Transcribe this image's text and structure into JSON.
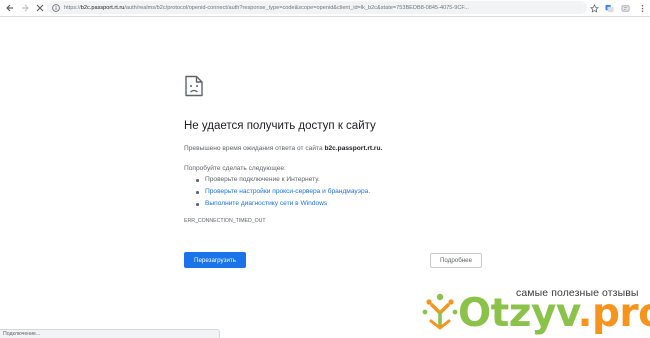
{
  "browser": {
    "url": {
      "scheme": "https://",
      "host": "b2c.passport.rt.ru",
      "rest": "/auth/realms/b2c/protocol/openid-connect/auth?response_type=code&scope=openid&client_id=lk_b2c&state=753BEDB8-0845-4075-9CF..."
    },
    "status_text": "Подключение..."
  },
  "error": {
    "title": "Не удается получить доступ к сайту",
    "description_prefix": "Превышено время ожидания ответа от сайта",
    "description_host": "b2c.passport.rt.ru.",
    "try_heading": "Попробуйте сделать следующее:",
    "suggestions": [
      {
        "text": "Проверьте подключение к Интернету.",
        "link": false
      },
      {
        "text": "Проверьте настройки прокси-сервера и брандмауэра.",
        "link": true
      },
      {
        "text": "Выполните диагностику сети в Windows",
        "link": true
      }
    ],
    "code": "ERR_CONNECTION_TIMED_OUT",
    "reload_label": "Перезагрузить",
    "details_label": "Подробнее"
  },
  "watermark": {
    "tagline": "самые полезные отзывы",
    "brand_green": "Otzyv",
    "brand_dot": ".",
    "brand_orange": "pro"
  },
  "colors": {
    "accent_blue": "#1a73e8",
    "brand_green": "#8bc34a",
    "brand_orange": "#f7941d"
  }
}
